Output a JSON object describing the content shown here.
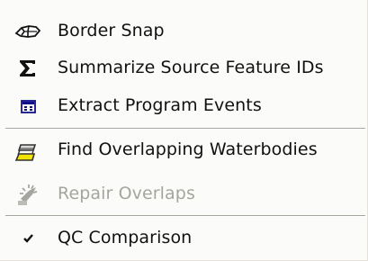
{
  "menu": {
    "items": [
      {
        "label": "Border Snap",
        "icon": "border-snap-icon",
        "enabled": true
      },
      {
        "label": "Summarize Source Feature IDs",
        "icon": "sigma-icon",
        "enabled": true
      },
      {
        "label": "Extract Program Events",
        "icon": "extract-events-icon",
        "enabled": true
      },
      {
        "label": "Find Overlapping Waterbodies",
        "icon": "overlapping-waterbodies-icon",
        "enabled": true
      },
      {
        "label": "Repair Overlaps",
        "icon": "repair-overlaps-icon",
        "enabled": false
      },
      {
        "label": "QC Comparison",
        "icon": "checkmark-icon",
        "enabled": true,
        "checked": true
      }
    ]
  },
  "colors": {
    "menu_background": "#fbfbf9",
    "text": "#111111",
    "disabled_text": "#a6a59d",
    "separator": "#a7a69e",
    "highlight_yellow": "#f2e400"
  }
}
